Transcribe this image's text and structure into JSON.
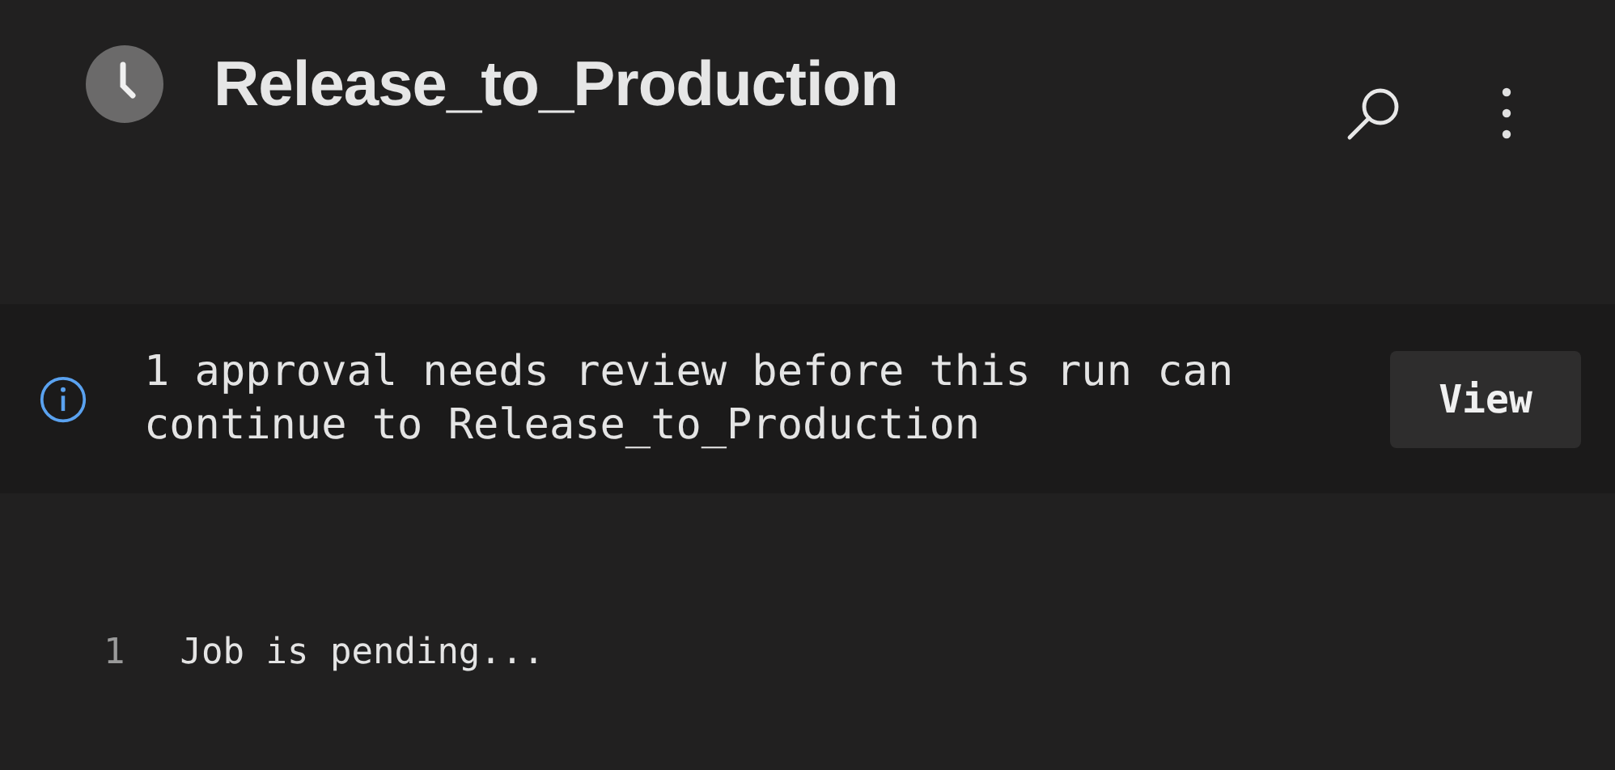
{
  "header": {
    "title": "Release_to_Production"
  },
  "banner": {
    "message": "1 approval needs review before this run can continue to Release_to_Production",
    "button": "View"
  },
  "log": [
    {
      "line": "1",
      "text": "Job is pending..."
    }
  ]
}
